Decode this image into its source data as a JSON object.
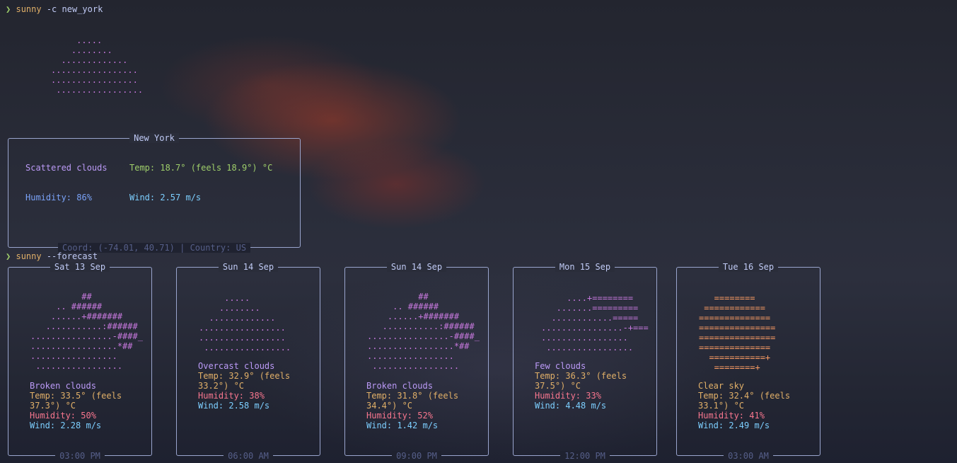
{
  "prompt1": {
    "arrow": "❯",
    "cmd": "sunny",
    "args": " -c new_york"
  },
  "current": {
    "art": "     .....\n    ........\n  .............\n.................\n.................\n .................",
    "title": "New York",
    "description": "Scattered clouds",
    "temp": "Temp: 18.7° (feels 18.9°) °C",
    "humidity": "Humidity: 86%",
    "wind": "Wind: 2.57 m/s",
    "footer": "Coord: (-74.01, 40.71) | Country: US"
  },
  "prompt2": {
    "arrow": "❯",
    "cmd": "sunny",
    "args": " --forecast"
  },
  "forecast": [
    {
      "day": "Sat 13 Sep",
      "art": "          ##\n     .. ######\n    ......+#######\n   ...........:######\n................-####_\n.................*##\n.................\n .................",
      "description": "Broken clouds",
      "temp": "Temp: 33.5° (feels 37.3°) °C",
      "humidity": "Humidity: 50%",
      "wind": "Wind: 2.28 m/s",
      "time": "03:00 PM"
    },
    {
      "day": "Sun 14 Sep",
      "art": "     .....\n    ........\n  .............\n.................\n.................\n .................",
      "description": "Overcast clouds",
      "temp": "Temp: 32.9° (feels 33.2°) °C",
      "humidity": "Humidity: 38%",
      "wind": "Wind: 2.58 m/s",
      "time": "06:00 AM"
    },
    {
      "day": "Sun 14 Sep",
      "art": "          ##\n     .. ######\n    ......+#######\n   ...........:######\n................-####_\n.................*##\n.................\n .................",
      "description": "Broken clouds",
      "temp": "Temp: 31.8° (feels 34.4°) °C",
      "humidity": "Humidity: 52%",
      "wind": "Wind: 1.42 m/s",
      "time": "09:00 PM"
    },
    {
      "day": "Mon 15 Sep",
      "art": "     ....+========\n   .......=========\n  ............=====\n................-+===\n.................\n .................",
      "description": "Few clouds",
      "temp": "Temp: 36.3° (feels 37.5°) °C",
      "humidity": "Humidity: 33%",
      "wind": "Wind: 4.48 m/s",
      "time": "12:00 PM"
    },
    {
      "day": "Tue 16 Sep",
      "art": "   ========\n ============\n==============\n===============\n===============\n==============\n  ===========+\n   ========+",
      "description": "Clear sky",
      "temp": "Temp: 32.4° (feels 33.1°) °C",
      "humidity": "Humidity: 41%",
      "wind": "Wind: 2.49 m/s",
      "time": "03:00 AM"
    }
  ],
  "colors": {
    "cloud_art": "#c678dd",
    "sun_art": "#ff9e64",
    "temp_current": "#9ece6a",
    "humidity_current": "#7aa2f7",
    "wind": "#7dcfff",
    "border": "#9aa5ce"
  }
}
